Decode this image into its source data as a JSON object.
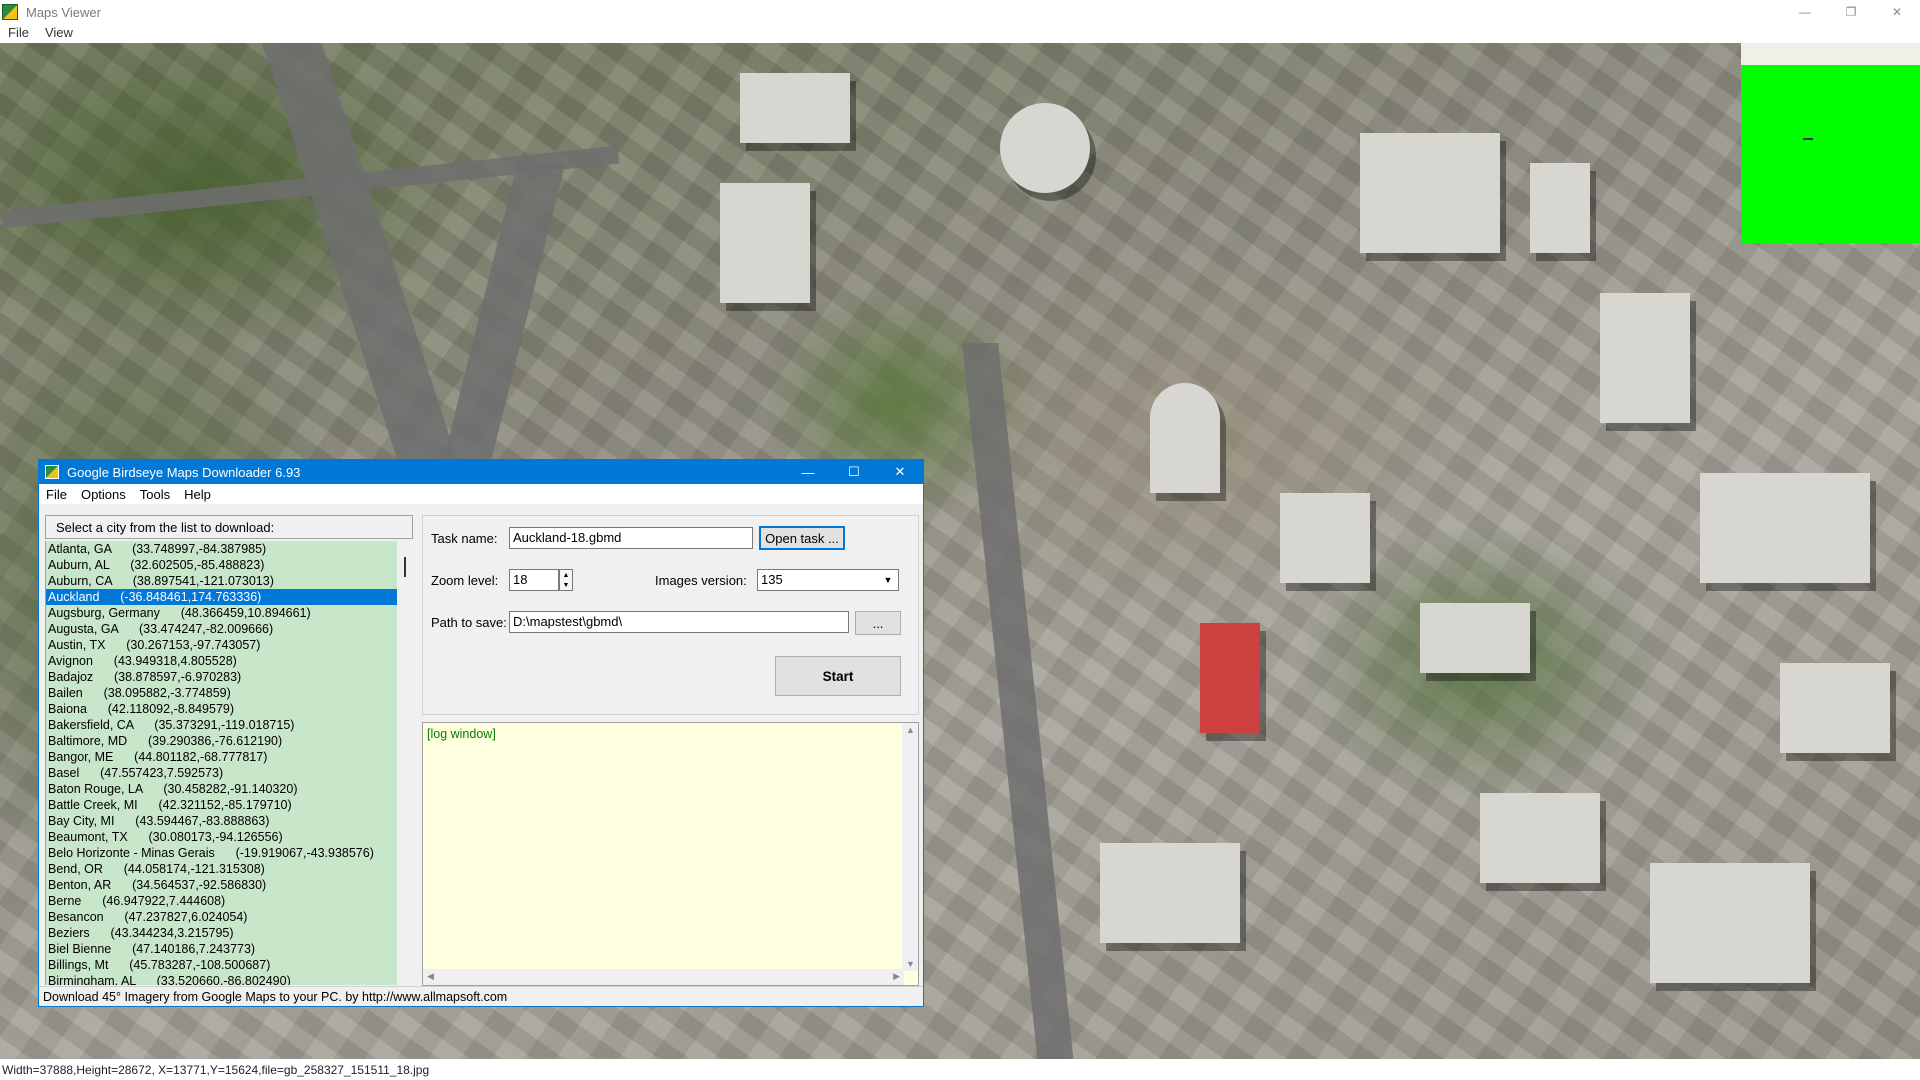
{
  "viewer": {
    "title": "Maps Viewer",
    "menu": [
      "File",
      "View"
    ],
    "window_buttons": [
      "—",
      "❐",
      "✕"
    ],
    "status": "Width=37888,Height=28672, X=13771,Y=15624,file=gb_258327_151511_18.jpg"
  },
  "dialog": {
    "title": "Google Birdseye Maps Downloader 6.93",
    "window_buttons": [
      "—",
      "☐",
      "✕"
    ],
    "menu": [
      "File",
      "Options",
      "Tools",
      "Help"
    ],
    "city_header": "Select a city from the list to download:",
    "cities": [
      "Atlanta, GA      (33.748997,-84.387985)",
      "Auburn, AL      (32.602505,-85.488823)",
      "Auburn, CA      (38.897541,-121.073013)",
      "Auckland      (-36.848461,174.763336)",
      "Augsburg, Germany      (48.366459,10.894661)",
      "Augusta, GA      (33.474247,-82.009666)",
      "Austin, TX      (30.267153,-97.743057)",
      "Avignon      (43.949318,4.805528)",
      "Badajoz      (38.878597,-6.970283)",
      "Bailen      (38.095882,-3.774859)",
      "Baiona      (42.118092,-8.849579)",
      "Bakersfield, CA      (35.373291,-119.018715)",
      "Baltimore, MD      (39.290386,-76.612190)",
      "Bangor, ME      (44.801182,-68.777817)",
      "Basel      (47.557423,7.592573)",
      "Baton Rouge, LA      (30.458282,-91.140320)",
      "Battle Creek, MI      (42.321152,-85.179710)",
      "Bay City, MI      (43.594467,-83.888863)",
      "Beaumont, TX      (30.080173,-94.126556)",
      "Belo Horizonte - Minas Gerais      (-19.919067,-43.938576)",
      "Bend, OR      (44.058174,-121.315308)",
      "Benton, AR      (34.564537,-92.586830)",
      "Berne      (46.947922,7.444608)",
      "Besancon      (47.237827,6.024054)",
      "Beziers      (43.344234,3.215795)",
      "Biel Bienne      (47.140186,7.243773)",
      "Billings, Mt      (45.783287,-108.500687)",
      "Birmingham, AL      (33.520660,-86.802490)"
    ],
    "selected_city_index": 3,
    "task_name_label": "Task name:",
    "task_name_value": "Auckland-18.gbmd",
    "open_task_label": "Open task ...",
    "zoom_label": "Zoom level:",
    "zoom_value": "18",
    "images_version_label": "Images version:",
    "images_version_value": "135",
    "path_label": "Path to save:",
    "path_value": "D:\\mapstest\\gbmd\\",
    "browse_label": "...",
    "start_label": "Start",
    "log_text": "[log window]",
    "status": "Download 45° Imagery from Google Maps to your PC.   by http://www.allmapsoft.com"
  },
  "colors": {
    "accent": "#0078d7",
    "list_bg": "#c8e6c9",
    "log_bg": "#ffffe0",
    "log_text": "#008000",
    "preview_green": "#00ff00"
  }
}
